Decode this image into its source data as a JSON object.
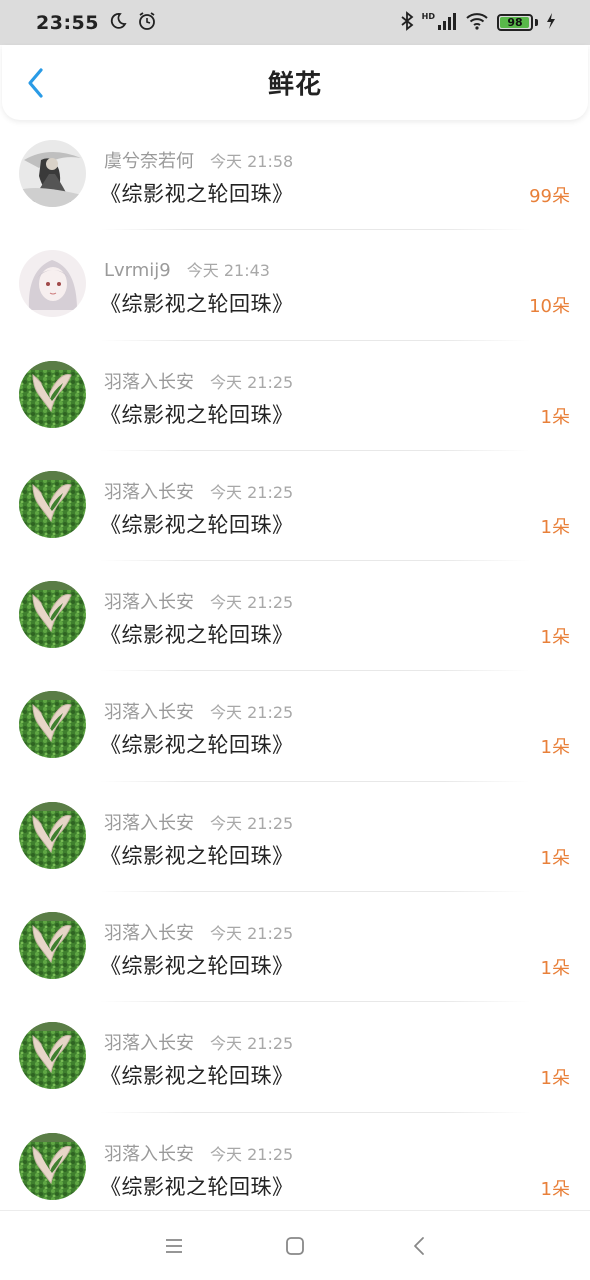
{
  "status": {
    "time": "23:55",
    "battery": "98",
    "battery_level": 0.98,
    "hd": "HD"
  },
  "header": {
    "title": "鲜花"
  },
  "rows": [
    {
      "name": "虞兮奈若何",
      "time": "今天 21:58",
      "title": "《综影视之轮回珠》",
      "count": "99朵",
      "avatar": "ink"
    },
    {
      "name": "Lvrmij9",
      "time": "今天 21:43",
      "title": "《综影视之轮回珠》",
      "count": "10朵",
      "avatar": "anime"
    },
    {
      "name": "羽落入长安",
      "time": "今天 21:25",
      "title": "《综影视之轮回珠》",
      "count": "1朵",
      "avatar": "grass-heart"
    },
    {
      "name": "羽落入长安",
      "time": "今天 21:25",
      "title": "《综影视之轮回珠》",
      "count": "1朵",
      "avatar": "grass-heart"
    },
    {
      "name": "羽落入长安",
      "time": "今天 21:25",
      "title": "《综影视之轮回珠》",
      "count": "1朵",
      "avatar": "grass-heart"
    },
    {
      "name": "羽落入长安",
      "time": "今天 21:25",
      "title": "《综影视之轮回珠》",
      "count": "1朵",
      "avatar": "grass-heart"
    },
    {
      "name": "羽落入长安",
      "time": "今天 21:25",
      "title": "《综影视之轮回珠》",
      "count": "1朵",
      "avatar": "grass-heart"
    },
    {
      "name": "羽落入长安",
      "time": "今天 21:25",
      "title": "《综影视之轮回珠》",
      "count": "1朵",
      "avatar": "grass-heart"
    },
    {
      "name": "羽落入长安",
      "time": "今天 21:25",
      "title": "《综影视之轮回珠》",
      "count": "1朵",
      "avatar": "grass-heart"
    },
    {
      "name": "羽落入长安",
      "time": "今天 21:25",
      "title": "《综影视之轮回珠》",
      "count": "1朵",
      "avatar": "grass-heart"
    }
  ],
  "colors": {
    "accent": "#e8803a",
    "back_arrow": "#2a9be6",
    "status_bar": "#dcdcdc"
  },
  "icons": {
    "back": "back-arrow-icon",
    "nav_menu": "menu-icon",
    "nav_home": "home-icon",
    "nav_back": "nav-back-icon"
  }
}
